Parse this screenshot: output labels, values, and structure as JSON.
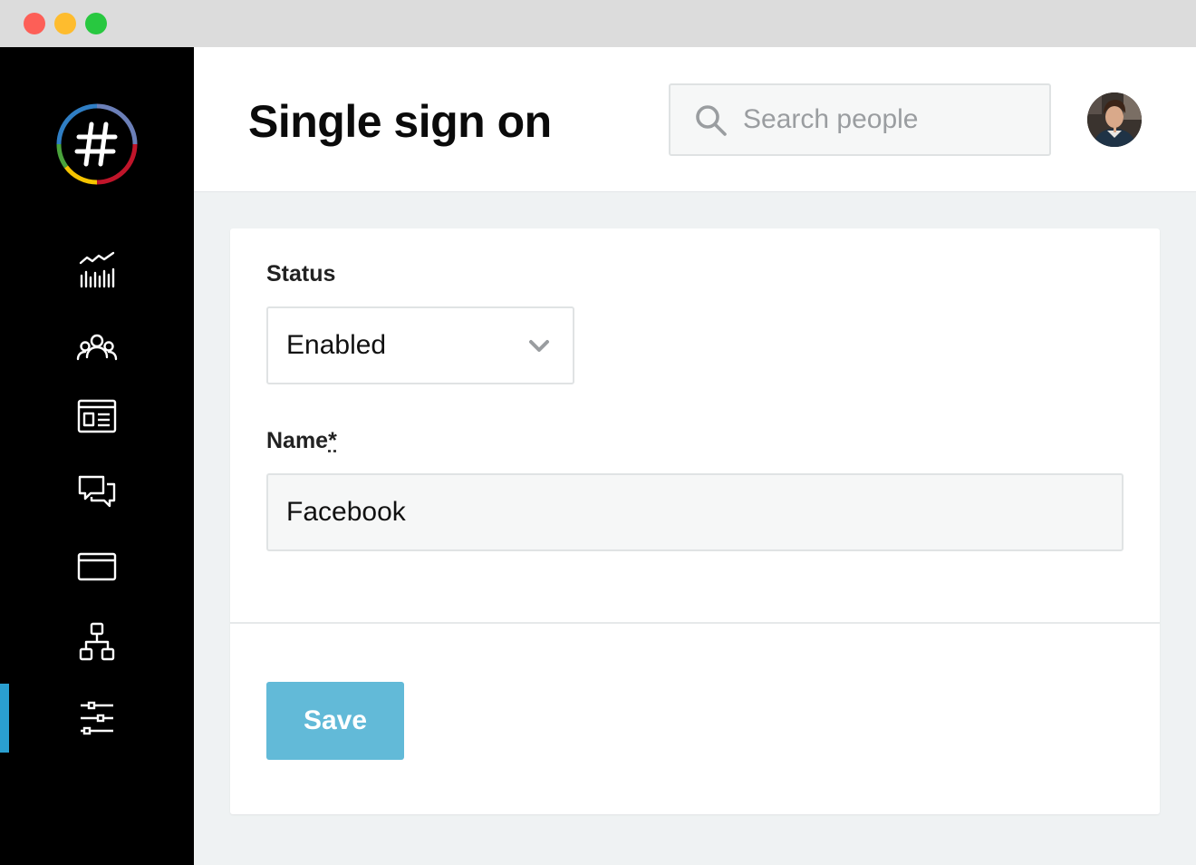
{
  "window": {
    "buttons": [
      "close",
      "minimize",
      "zoom"
    ]
  },
  "sidebar": {
    "logo_icon": "hashtag-logo-icon",
    "active_color": "#2a9fd0",
    "items": [
      {
        "id": "analytics",
        "icon": "analytics-icon"
      },
      {
        "id": "people",
        "icon": "people-icon"
      },
      {
        "id": "news",
        "icon": "newspaper-icon"
      },
      {
        "id": "messages",
        "icon": "chat-icon"
      },
      {
        "id": "window",
        "icon": "window-icon"
      },
      {
        "id": "org",
        "icon": "org-chart-icon"
      },
      {
        "id": "settings",
        "icon": "sliders-icon",
        "active": true
      }
    ]
  },
  "header": {
    "title": "Single sign on",
    "search": {
      "placeholder": "Search people",
      "value": ""
    },
    "avatar": "user-avatar"
  },
  "form": {
    "status": {
      "label": "Status",
      "selected": "Enabled"
    },
    "name": {
      "label": "Name",
      "required_marker": "*",
      "value": "Facebook"
    },
    "save_label": "Save",
    "save_color": "#62bad8"
  }
}
